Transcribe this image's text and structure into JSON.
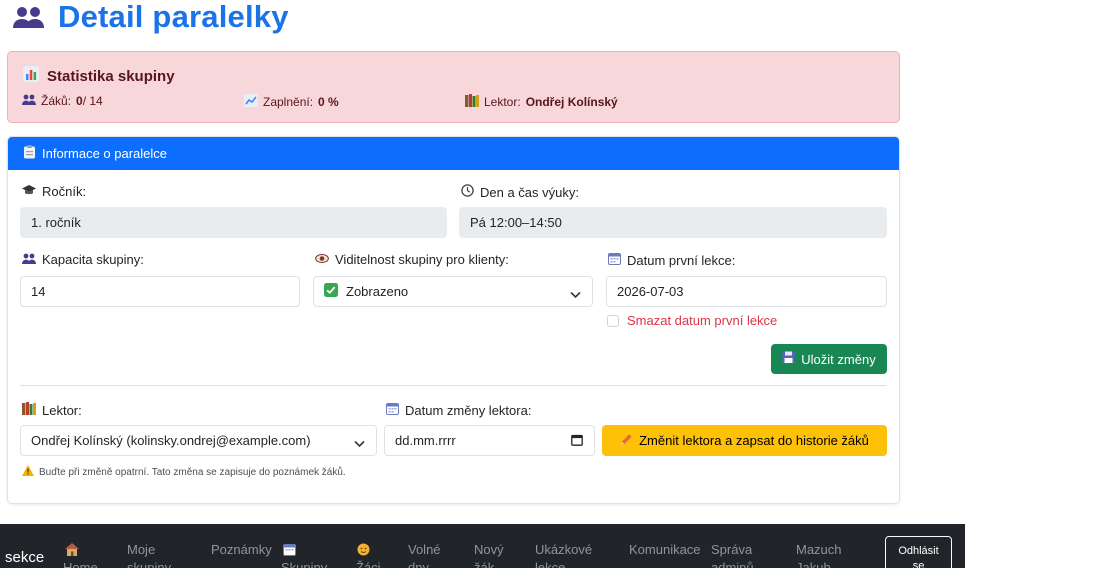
{
  "page": {
    "title": "Detail paralelky"
  },
  "stats": {
    "title": "Statistika skupiny",
    "students_label": "Žáků:",
    "students_count": "0",
    "students_capacity": " / 14",
    "fill_label": "Zaplnění:",
    "fill_value": "0 %",
    "lector_label": "Lektor:",
    "lector_value": "Ondřej Kolínský"
  },
  "info": {
    "header": "Informace o paralelce",
    "grade_label": "Ročník:",
    "grade_value": "1. ročník",
    "schedule_label": "Den a čas výuky:",
    "schedule_value": "Pá 12:00–14:50",
    "capacity_label": "Kapacita skupiny:",
    "capacity_value": "14",
    "visibility_label": "Viditelnost skupiny pro klienty:",
    "visibility_value": "Zobrazeno",
    "first_lesson_label": "Datum první lekce:",
    "first_lesson_value": "2026-07-03",
    "delete_first_lesson_label": "Smazat datum první lekce",
    "save_label": "Uložit změny",
    "lector_label": "Lektor:",
    "lector_value": "Ondřej Kolínský (kolinsky.ondrej@example.com)",
    "lector_change_date_label": "Datum změny lektora:",
    "lector_change_date_placeholder": "dd.mm.rrrr",
    "change_lector_label": "Změnit lektora a zapsat do historie žáků",
    "warning": "Buďte při změně opatrní. Tato změna se zapisuje do poznámek žáků."
  },
  "nav": {
    "brand": "sekce",
    "items": [
      {
        "label": "Home",
        "icon": "house-icon"
      },
      {
        "label": "Moje\nskupiny",
        "icon": ""
      },
      {
        "label": "Poznámky",
        "icon": ""
      },
      {
        "label": "Skupiny",
        "icon": "calendar-icon"
      },
      {
        "label": "Žáci",
        "icon": "student-icon"
      },
      {
        "label": "Volné\ndny",
        "icon": ""
      },
      {
        "label": "Nový\nžák",
        "icon": ""
      },
      {
        "label": "Ukázkové\nlekce",
        "icon": ""
      },
      {
        "label": "Komunikace",
        "icon": ""
      },
      {
        "label": "Správa\nadminů",
        "icon": ""
      },
      {
        "label": "Mazuch\nJakub",
        "icon": ""
      }
    ],
    "logout": "Odhlásit\nse"
  },
  "colors": {
    "title": "#1a73e8",
    "card_header": "#0d6efd",
    "stats_bg": "#f8d7da",
    "save_button": "#198754",
    "change_button": "#ffc107",
    "danger_text": "#dc3545",
    "navbar": "#212529"
  }
}
